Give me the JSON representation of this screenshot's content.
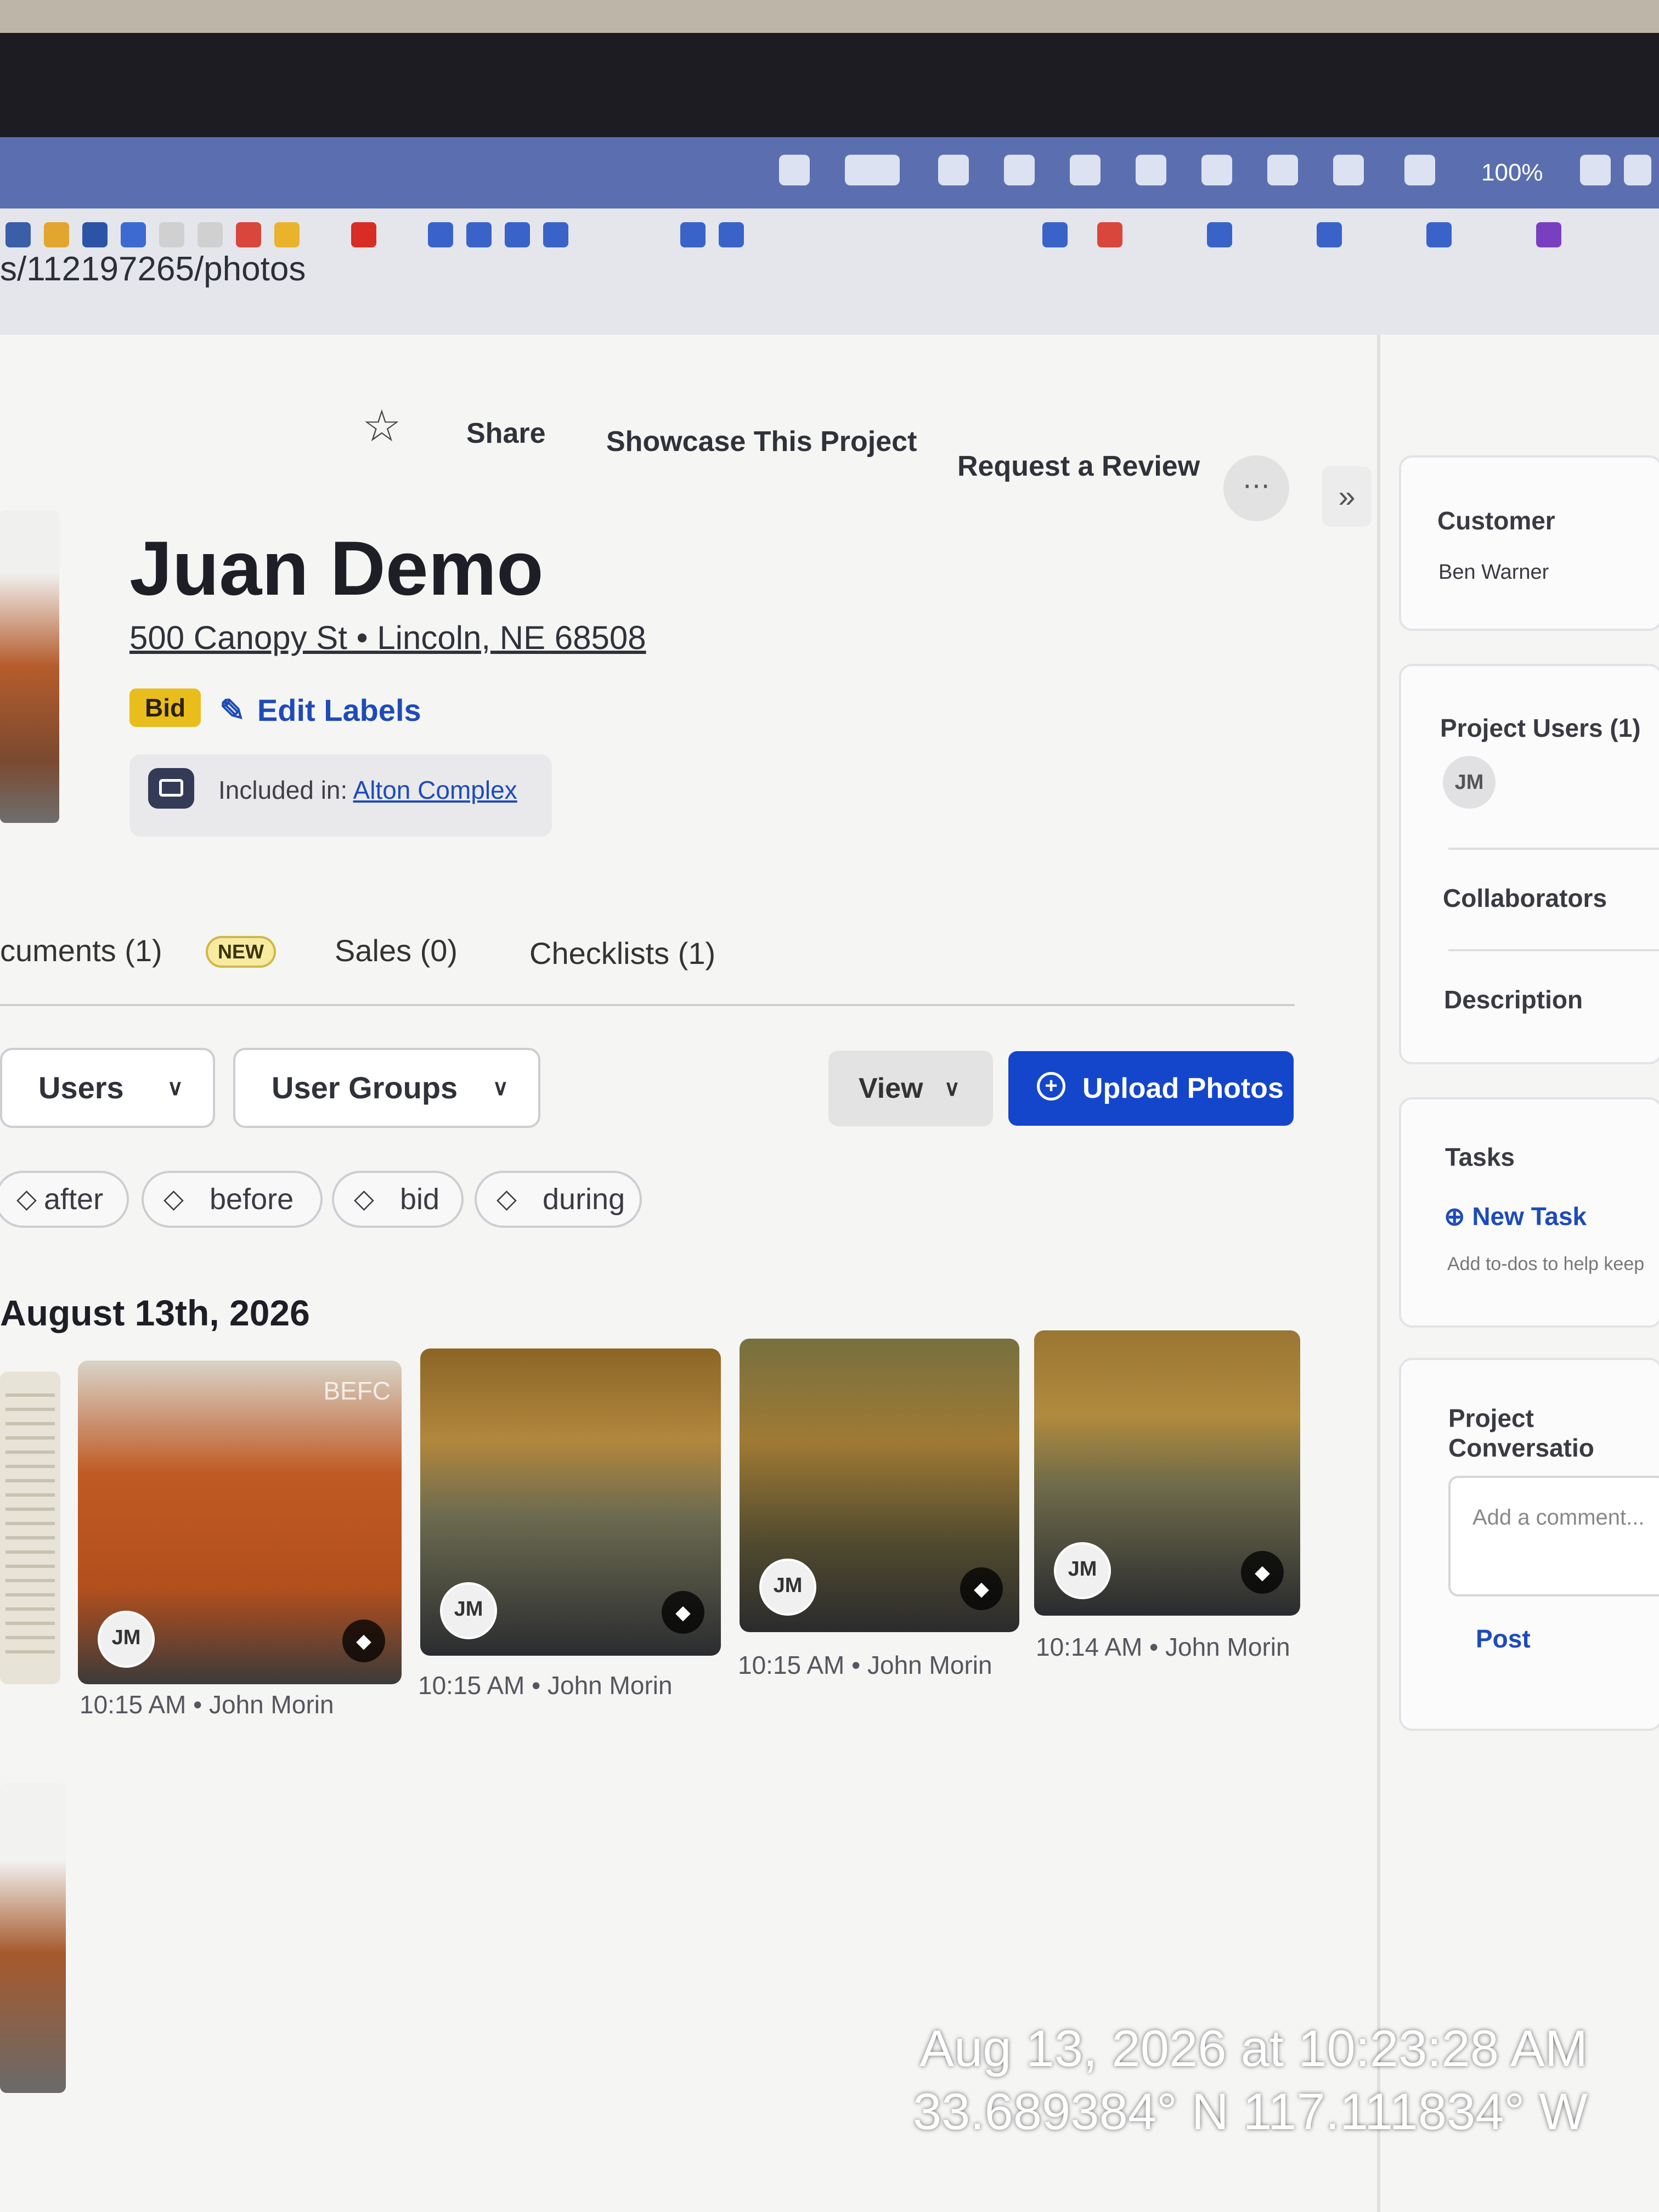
{
  "browser": {
    "url_fragment": "s/112197265/photos",
    "battery": "100%"
  },
  "header_actions": {
    "share": "Share",
    "showcase": "Showcase This Project",
    "request_review": "Request a Review",
    "more": "⋯",
    "collapse": "»"
  },
  "project": {
    "title": "Juan Demo",
    "address": "500 Canopy St • Lincoln, NE 68508",
    "label_bid": "Bid",
    "edit_labels": "Edit Labels",
    "included_prefix": "Included in: ",
    "included_link": "Alton Complex"
  },
  "tabs": {
    "documents": "cuments  (1)",
    "documents_badge": "NEW",
    "sales": "Sales  (0)",
    "checklists": "Checklists  (1)"
  },
  "filters": {
    "users": "Users",
    "user_groups": "User Groups",
    "view": "View",
    "upload": "Upload Photos",
    "tags": [
      "after",
      "before",
      "bid",
      "during"
    ]
  },
  "gallery": {
    "date_heading": "August 13th, 2026",
    "photos": [
      {
        "avatar": "JM",
        "caption": "10:15 AM • John Morin",
        "stamp": "BEFC"
      },
      {
        "avatar": "JM",
        "caption": "10:15 AM • John Morin"
      },
      {
        "avatar": "JM",
        "caption": "10:15 AM • John Morin"
      },
      {
        "avatar": "JM",
        "caption": "10:14 AM • John Morin"
      }
    ]
  },
  "sidebar": {
    "customer_title": "Customer",
    "customer_name": "Ben Warner",
    "project_users": "Project Users (1)",
    "project_user_initials": "JM",
    "collaborators": "Collaborators",
    "description": "Description",
    "tasks": "Tasks",
    "new_task": "New Task",
    "tasks_hint": "Add to-dos to help keep",
    "conversation": "Project Conversatio",
    "comment_placeholder": "Add a comment...",
    "post": "Post"
  },
  "camera_overlay": {
    "timestamp": "Aug 13, 2026 at 10:23:28 AM",
    "coordinates": "33.689384° N 117.111834° W"
  },
  "colors": {
    "accent_blue": "#1446cc",
    "bid_yellow": "#e9bd1c"
  }
}
